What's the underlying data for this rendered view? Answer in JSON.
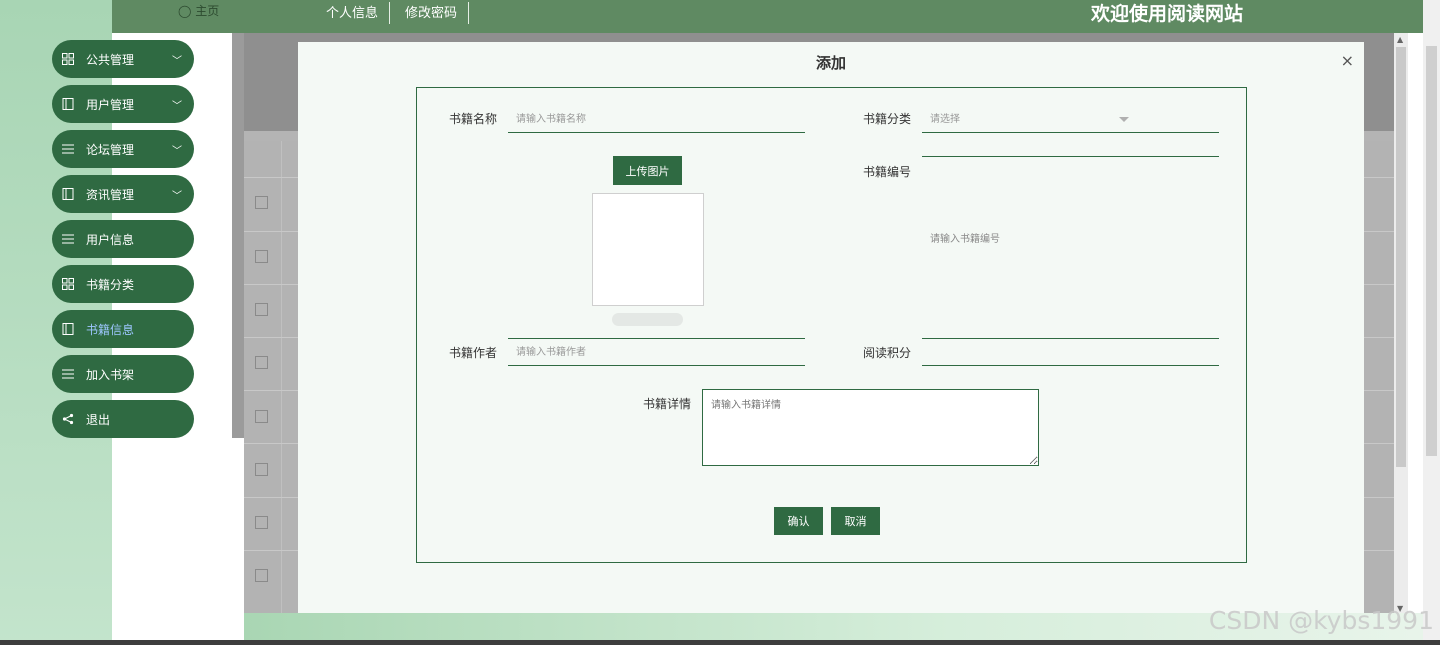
{
  "topbar": {
    "home": "◯ 主页",
    "nav": [
      "个人信息",
      "修改密码"
    ],
    "welcome": "欢迎使用阅读网站"
  },
  "sidebar": {
    "items": [
      {
        "label": "公共管理",
        "icon": "grid-icon",
        "chevron": true
      },
      {
        "label": "用户管理",
        "icon": "book-icon",
        "chevron": true
      },
      {
        "label": "论坛管理",
        "icon": "list-icon",
        "chevron": true
      },
      {
        "label": "资讯管理",
        "icon": "book-icon",
        "chevron": true
      },
      {
        "label": "用户信息",
        "icon": "list-icon",
        "chevron": false
      },
      {
        "label": "书籍分类",
        "icon": "grid-icon",
        "chevron": false
      },
      {
        "label": "书籍信息",
        "icon": "book-icon",
        "chevron": false,
        "active": true
      },
      {
        "label": "加入书架",
        "icon": "list-icon",
        "chevron": false
      },
      {
        "label": "退出",
        "icon": "share-icon",
        "chevron": false
      }
    ]
  },
  "modal": {
    "title": "添加",
    "close": "×",
    "fields": {
      "book_name": {
        "label": "书籍名称",
        "placeholder": "请输入书籍名称"
      },
      "book_category": {
        "label": "书籍分类",
        "placeholder": "请选择"
      },
      "upload_button": "上传图片",
      "book_number": {
        "label": "书籍编号",
        "placeholder": "请输入书籍编号"
      },
      "book_author": {
        "label": "书籍作者",
        "placeholder": "请输入书籍作者"
      },
      "read_points": {
        "label": "阅读积分",
        "placeholder": ""
      },
      "book_detail": {
        "label": "书籍详情",
        "placeholder": "请输入书籍详情"
      }
    },
    "confirm": "确认",
    "cancel": "取消"
  },
  "watermark": "CSDN @kybs1991",
  "colors": {
    "primary": "#2f6a42",
    "topbar": "#5f8a62",
    "accent_active": "#9ec7ff"
  }
}
